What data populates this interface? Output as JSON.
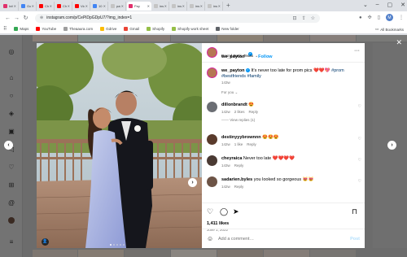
{
  "browser": {
    "tabs": [
      {
        "title": "Info",
        "color": "#e1306c"
      },
      {
        "title": "Goo",
        "color": "#4285f4"
      },
      {
        "title": "Chu",
        "color": "#ff0000"
      },
      {
        "title": "Chi",
        "color": "#ff0000"
      },
      {
        "title": "Vide",
        "color": "#ff0000"
      },
      {
        "title": "10 I",
        "color": "#4285f4"
      },
      {
        "title": "pay",
        "color": "#c4c4c4"
      },
      {
        "title": "Pay",
        "color": "#e1306c",
        "active": true
      },
      {
        "title": "inst",
        "color": "#c4c4c4"
      },
      {
        "title": "inst",
        "color": "#c4c4c4"
      },
      {
        "title": "inst",
        "color": "#c4c4c4"
      },
      {
        "title": "inst",
        "color": "#c4c4c4"
      }
    ],
    "new_tab": "+",
    "url": "instagram.com/p/CePiDpGDpU7/?img_index=1",
    "bookmarks": [
      {
        "label": "Maps",
        "color": "#34a853"
      },
      {
        "label": "YouTube",
        "color": "#ff0000"
      },
      {
        "label": "Theaaura.com",
        "color": "#9e9e9e"
      },
      {
        "label": "Gdrive",
        "color": "#fbbc04"
      },
      {
        "label": "Gmail",
        "color": "#ea4335"
      },
      {
        "label": "Shopify",
        "color": "#95bf47"
      },
      {
        "label": "Shopify work sheet",
        "color": "#95bf47"
      },
      {
        "label": "New folder",
        "color": "#5f6368"
      }
    ],
    "all_bookmarks": "All Bookmarks"
  },
  "post": {
    "username": "we_payton",
    "follow_label": "Follow",
    "location": "Round Rock, Texas",
    "caption_text": "It's never too late for prom pics ❤️❤️💖",
    "caption_tags": "#prom #bestfriends #family",
    "caption_age": "143w",
    "for_you": "For you",
    "comments": [
      {
        "user": "dillonbrandt",
        "text": "😍",
        "age": "142w",
        "likes": "2 likes",
        "reply": "Reply",
        "view_replies": "View replies (1)"
      },
      {
        "user": "destinyyybrownnn",
        "text": "😍😍😍",
        "age": "142w",
        "likes": "1 like",
        "reply": "Reply"
      },
      {
        "user": "cheyraica",
        "text": "Never too late ❤️❤️❤️❤️",
        "age": "143w",
        "reply": "Reply"
      },
      {
        "user": "sadarien.byles",
        "text": "you looked so gorgeous 😻😻",
        "age": "142w",
        "reply": "Reply"
      }
    ],
    "likes": "1,411 likes",
    "date": "June 1, 2022",
    "add_comment_placeholder": "Add a comment…",
    "post_button": "Post"
  }
}
